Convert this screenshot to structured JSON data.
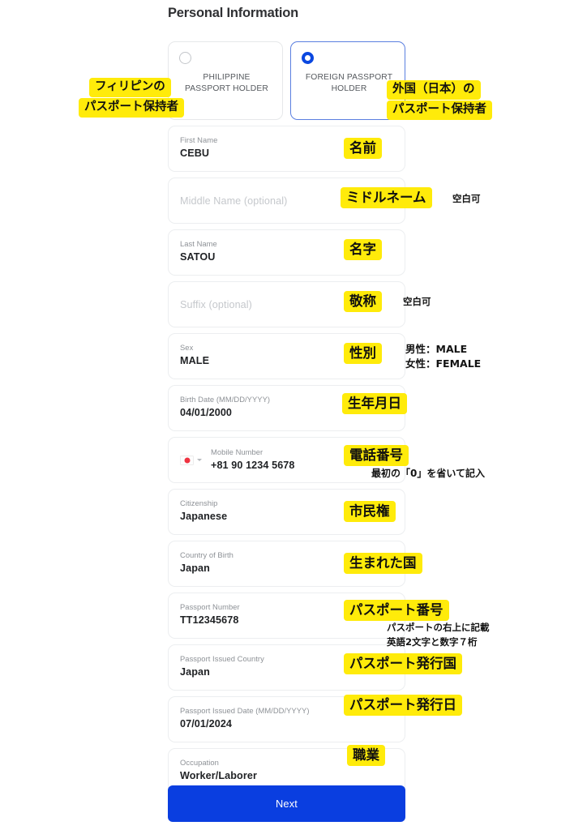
{
  "page": {
    "title": "Personal Information"
  },
  "passport_type": {
    "options": [
      {
        "label": "PHILIPPINE PASSPORT HOLDER",
        "selected": false
      },
      {
        "label": "FOREIGN PASSPORT HOLDER",
        "selected": true
      }
    ]
  },
  "form": {
    "fields": [
      {
        "label": "First Name",
        "value": "CEBU",
        "placeholder": ""
      },
      {
        "label": "",
        "value": "",
        "placeholder": "Middle Name (optional)"
      },
      {
        "label": "Last Name",
        "value": "SATOU",
        "placeholder": ""
      },
      {
        "label": "",
        "value": "",
        "placeholder": "Suffix (optional)"
      },
      {
        "label": "Sex",
        "value": "MALE",
        "placeholder": ""
      },
      {
        "label": "Birth Date (MM/DD/YYYY)",
        "value": "04/01/2000",
        "placeholder": ""
      },
      {
        "label": "Mobile Number",
        "value": "+81 90 1234 5678",
        "placeholder": "",
        "country_flag": "japan-flag-icon"
      },
      {
        "label": "Citizenship",
        "value": "Japanese",
        "placeholder": ""
      },
      {
        "label": "Country of Birth",
        "value": "Japan",
        "placeholder": ""
      },
      {
        "label": "Passport Number",
        "value": "TT12345678",
        "placeholder": ""
      },
      {
        "label": "Passport Issued Country",
        "value": "Japan",
        "placeholder": ""
      },
      {
        "label": "Passport Issued Date (MM/DD/YYYY)",
        "value": "07/01/2024",
        "placeholder": ""
      },
      {
        "label": "Occupation",
        "value": "Worker/Laborer",
        "placeholder": ""
      }
    ]
  },
  "actions": {
    "next_label": "Next"
  },
  "annotations": {
    "highlight_color": "#ffeb0a",
    "philippine_line1": "フィリピンの",
    "philippine_line2": "パスポート保持者",
    "foreign_line1": "外国（日本）の",
    "foreign_line2": "パスポート保持者",
    "first_name": "名前",
    "middle_name": "ミドルネーム",
    "middle_name_note": "空白可",
    "last_name": "名字",
    "suffix": "敬称",
    "suffix_note": "空白可",
    "sex": "性別",
    "sex_note_line1": "男性：MALE",
    "sex_note_line2": "女性：FEMALE",
    "birth_date": "生年月日",
    "mobile": "電話番号",
    "mobile_note": "最初の「0」を省いて記入",
    "citizenship": "市民権",
    "country_of_birth": "生まれた国",
    "passport_number": "パスポート番号",
    "passport_number_note_line1": "パスポートの右上に記載",
    "passport_number_note_line2": "英語2文字と数字７桁",
    "passport_issued_country": "パスポート発行国",
    "passport_issued_date": "パスポート発行日",
    "occupation": "職業"
  }
}
